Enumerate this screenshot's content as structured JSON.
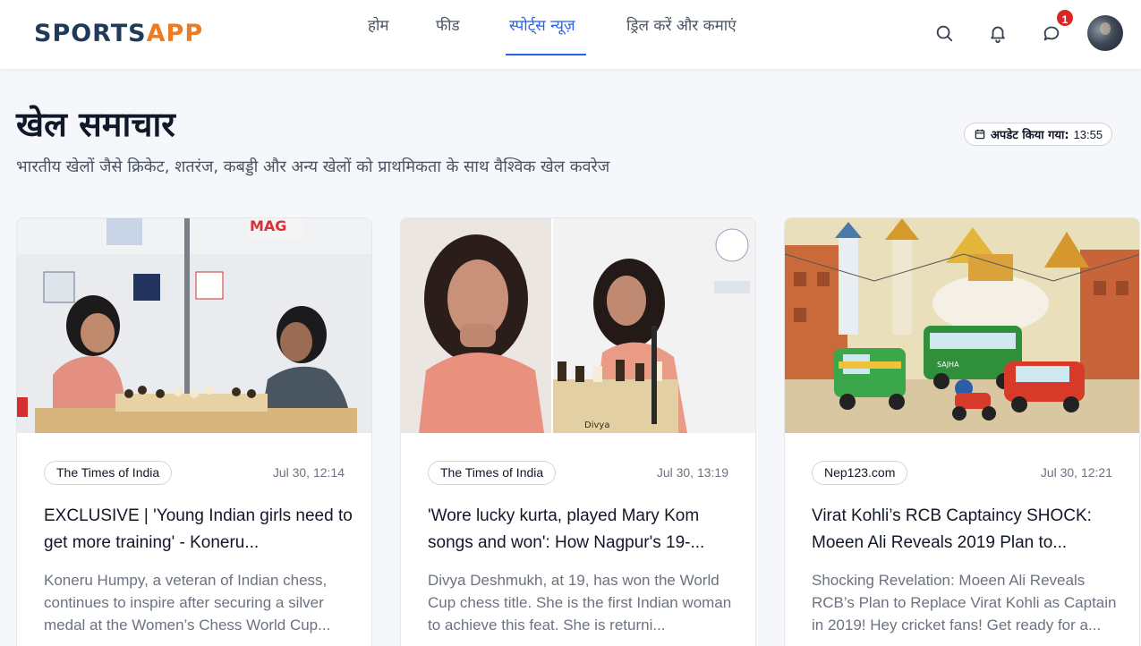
{
  "brand": {
    "logo_part1": "SPORTS",
    "logo_part2": "APP",
    "primary": "#2563eb",
    "accent": "#f07a1f"
  },
  "nav": {
    "items": [
      {
        "label": "होम"
      },
      {
        "label": "फीड"
      },
      {
        "label": "स्पोर्ट्स न्यूज़",
        "active": true
      },
      {
        "label": "ड्रिल करें और कमाएं"
      }
    ]
  },
  "header_icons": {
    "search": "search-icon",
    "notifications": "bell-icon",
    "messages": "chat-icon",
    "messages_badge": "1",
    "avatar": "avatar"
  },
  "page": {
    "title": "खेल समाचार",
    "subtitle": "भारतीय खेलों जैसे क्रिकेट, शतरंज, कबड्डी और अन्य खेलों को प्राथमिकता के साथ वैश्विक खेल कवरेज",
    "updated_label": "अपडेट किया गया:",
    "updated_time": "13:55"
  },
  "articles": [
    {
      "source": "The Times of India",
      "time": "Jul 30, 12:14",
      "title": "EXCLUSIVE | 'Young Indian girls need to get more training' - Koneru...",
      "description": "Koneru Humpy, a veteran of Indian chess, continues to inspire after securing a silver medal at the Women’s Chess World Cup...",
      "image": "chess-match-photo"
    },
    {
      "source": "The Times of India",
      "time": "Jul 30, 13:19",
      "title": "'Wore lucky kurta, played Mary Kom songs and won': How Nagpur's 19-...",
      "description": "Divya Deshmukh, at 19, has won the World Cup chess title. She is the first Indian woman to achieve this feat. She is returni...",
      "image": "chess-player-photo",
      "image_caption": "Divya"
    },
    {
      "source": "Nep123.com",
      "time": "Jul 30, 12:21",
      "title": "Virat Kohli’s RCB Captaincy SHOCK: Moeen Ali Reveals 2019 Plan to...",
      "description": "Shocking Revelation: Moeen Ali Reveals RCB’s Plan to Replace Virat Kohli as Captain in 2019! Hey cricket fans! Get ready for a...",
      "image": "kathmandu-street-illustration",
      "image_bus_text": "SAJHA"
    }
  ]
}
